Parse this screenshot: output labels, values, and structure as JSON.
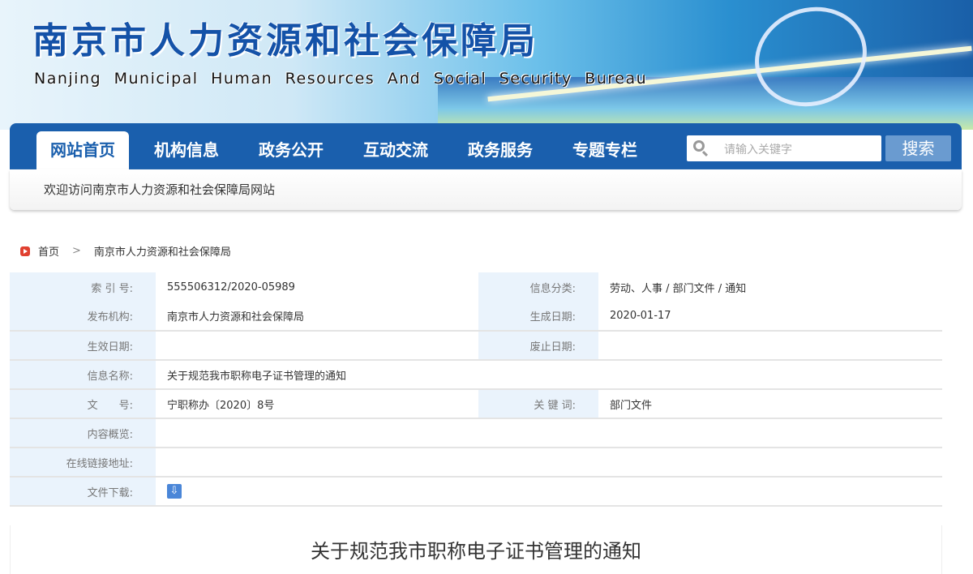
{
  "header": {
    "title_cn": "南京市人力资源和社会保障局",
    "title_en": "Nanjing Municipal Human Resources And Social Security Bureau"
  },
  "nav": {
    "items": [
      "网站首页",
      "机构信息",
      "政务公开",
      "互动交流",
      "政务服务",
      "专题专栏"
    ],
    "search_placeholder": "请输入关键字",
    "search_button": "搜索"
  },
  "welcome": "欢迎访问南京市人力资源和社会保障局网站",
  "breadcrumb": [
    "首页",
    "南京市人力资源和社会保障局"
  ],
  "info": {
    "index_label": "索 引 号:",
    "index": "555506312/2020-05989",
    "category_label": "信息分类:",
    "category": "劳动、人事 / 部门文件 / 通知",
    "publisher_label": "发布机构:",
    "publisher": "南京市人力资源和社会保障局",
    "created_label": "生成日期:",
    "created": "2020-01-17",
    "effective_label": "生效日期:",
    "effective": "",
    "expired_label": "废止日期:",
    "expired": "",
    "name_label": "信息名称:",
    "name": "关于规范我市职称电子证书管理的通知",
    "docno_label": "文　　号:",
    "docno": "宁职称办〔2020〕8号",
    "keywords_label": "关 键 词:",
    "keywords": "部门文件",
    "summary_label": "内容概览:",
    "summary": "",
    "link_label": "在线链接地址:",
    "link": "",
    "download_label": "文件下载:"
  },
  "article_title": "关于规范我市职称电子证书管理的通知"
}
